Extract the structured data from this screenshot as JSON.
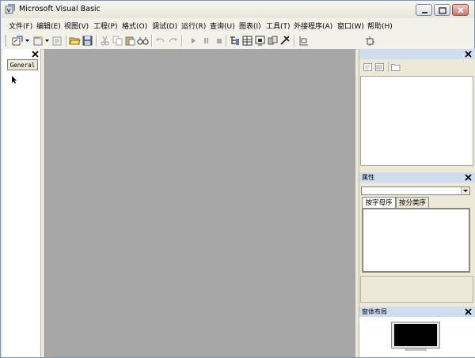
{
  "window": {
    "title": "Microsoft Visual Basic"
  },
  "menu": [
    {
      "label": "文件(F)"
    },
    {
      "label": "编辑(E)"
    },
    {
      "label": "视图(V)"
    },
    {
      "label": "工程(P)"
    },
    {
      "label": "格式(O)"
    },
    {
      "label": "调试(D)"
    },
    {
      "label": "运行(R)"
    },
    {
      "label": "查询(U)"
    },
    {
      "label": "图表(I)"
    },
    {
      "label": "工具(T)"
    },
    {
      "label": "外接程序(A)"
    },
    {
      "label": "窗口(W)"
    },
    {
      "label": "帮助(H)"
    }
  ],
  "toolbox": {
    "tab_label": "General"
  },
  "properties": {
    "header": "属性",
    "tabs": [
      "按字母序",
      "按分类序"
    ]
  },
  "form_layout": {
    "header": "窗体布局"
  },
  "colors": {
    "mdi_background": "#a7a7a7",
    "panel_header": "#cfddee",
    "chrome": "#ece9d8"
  }
}
